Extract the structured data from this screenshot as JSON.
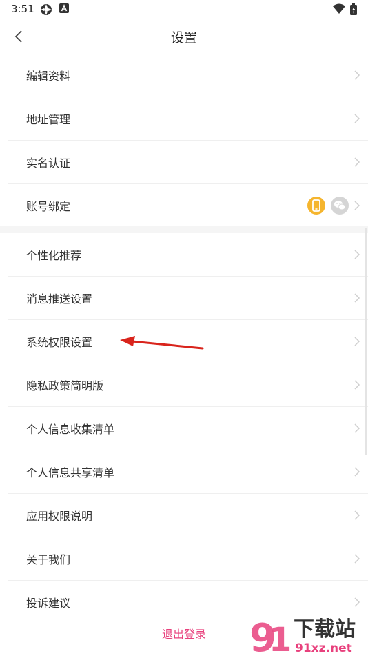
{
  "status_bar": {
    "time": "3:51"
  },
  "header": {
    "title": "设置"
  },
  "account_group": [
    {
      "label": "编辑资料"
    },
    {
      "label": "地址管理"
    },
    {
      "label": "实名认证"
    },
    {
      "label": "账号绑定"
    }
  ],
  "settings_group": [
    {
      "label": "个性化推荐"
    },
    {
      "label": "消息推送设置"
    },
    {
      "label": "系统权限设置"
    },
    {
      "label": "隐私政策简明版"
    },
    {
      "label": "个人信息收集清单"
    },
    {
      "label": "个人信息共享清单"
    },
    {
      "label": "应用权限说明"
    },
    {
      "label": "关于我们"
    },
    {
      "label": "投诉建议"
    }
  ],
  "footer": {
    "logout_label": "退出登录"
  },
  "watermark": {
    "brand": "下载站",
    "site": "91xz.net"
  },
  "icons": {
    "back": "chevron-left-icon",
    "row_arrow": "chevron-right-icon",
    "phone_bind": "phone-icon",
    "wechat_bind": "wechat-icon"
  },
  "colors": {
    "accent": "#e8417d",
    "phone_bind": "#f5b52e",
    "wechat_bind": "#d5d5d5",
    "annotation_arrow": "#d9241c"
  }
}
